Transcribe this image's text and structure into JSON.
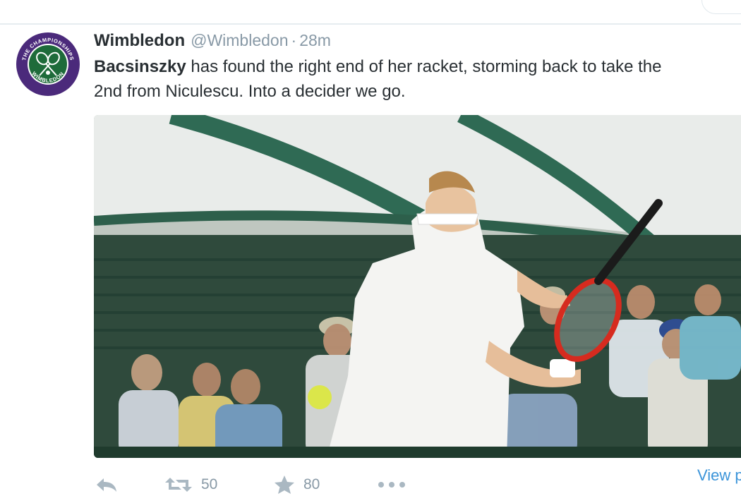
{
  "tweet": {
    "fullname": "Wimbledon",
    "screen_name": "@Wimbledon",
    "separator": "·",
    "timestamp": "28m",
    "text_bold": "Bacsinszky",
    "text_line1_rest": " has found the right end of her racket, storming back to take the",
    "text_line2": "2nd from Niculescu. Into a decider we go.",
    "avatar": {
      "ring_text_top": "THE CHAMPIONSHIPS",
      "ring_text_bottom": "WIMBLEDON",
      "colors": {
        "ring": "#4b2a7b",
        "inner": "#1e6b3a"
      }
    },
    "media": {
      "description_icon": "tennis-photo"
    },
    "actions": {
      "reply": {
        "icon": "reply-icon"
      },
      "retweet": {
        "icon": "retweet-icon",
        "count": "50"
      },
      "favorite": {
        "icon": "star-icon",
        "count": "80"
      },
      "more": {
        "icon": "more-icon"
      }
    },
    "view_link": "View p"
  },
  "colors": {
    "accent": "#3b94d9",
    "muted": "#8899a6",
    "icon": "#aab8c2"
  }
}
